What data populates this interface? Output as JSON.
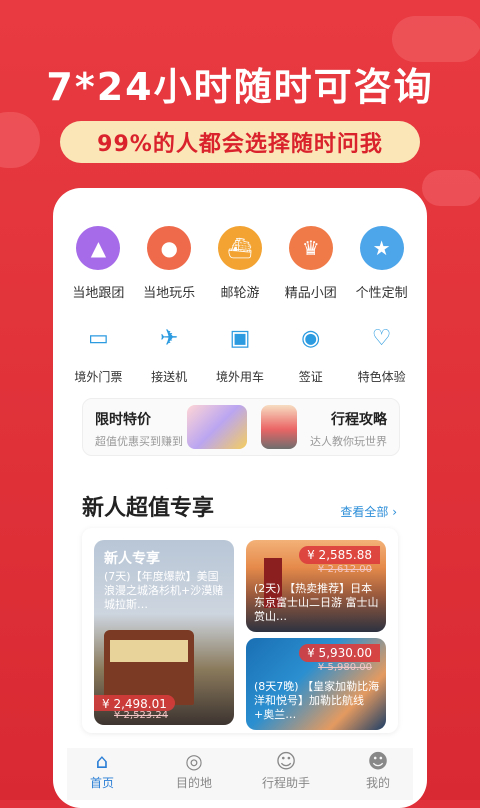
{
  "headline": "7*24小时随时可咨询",
  "subheadline": "99%的人都会选择随时问我",
  "categories_primary": [
    {
      "label": "当地跟团",
      "icon": "mountain-icon",
      "color": "#a56be8"
    },
    {
      "label": "当地玩乐",
      "icon": "location-pin-icon",
      "color": "#ef6a4a"
    },
    {
      "label": "邮轮游",
      "icon": "cruise-ship-icon",
      "color": "#f2a331"
    },
    {
      "label": "精品小团",
      "icon": "crown-icon",
      "color": "#f07a48"
    },
    {
      "label": "个性定制",
      "icon": "star-badge-icon",
      "color": "#4da5ea"
    }
  ],
  "categories_secondary": [
    {
      "label": "境外门票",
      "icon": "ticket-icon"
    },
    {
      "label": "接送机",
      "icon": "airplane-icon"
    },
    {
      "label": "境外用车",
      "icon": "bus-icon"
    },
    {
      "label": "签证",
      "icon": "passport-icon"
    },
    {
      "label": "特色体验",
      "icon": "heart-icon"
    }
  ],
  "promo": {
    "left_title": "限时特价",
    "left_sub": "超值优惠买到赚到",
    "right_title": "行程攻略",
    "right_sub": "达人教你玩世界"
  },
  "section": {
    "title": "新人超值专享",
    "see_all": "查看全部"
  },
  "deals": {
    "big": {
      "tag": "新人专享",
      "desc": "(7天)【年度爆款】美国浪漫之城洛杉机+沙漠赌城拉斯…",
      "price": "¥ 2,498.01",
      "old_price": "¥ 2,523.24"
    },
    "small1": {
      "price": "¥ 2,585.88",
      "old_price": "¥ 2,612.00",
      "desc": "(2天) 【热卖推荐】日本东京富士山二日游 富士山赏山…"
    },
    "small2": {
      "price": "¥ 5,930.00",
      "old_price": "¥ 5,980.00",
      "desc": "(8天7晚) 【皇家加勒比海洋和悦号】加勒比航线+奥兰…"
    }
  },
  "nav": [
    {
      "label": "首页",
      "icon": "home-icon",
      "active": true
    },
    {
      "label": "目的地",
      "icon": "destination-icon"
    },
    {
      "label": "行程助手",
      "icon": "assistant-icon"
    },
    {
      "label": "我的",
      "icon": "profile-icon"
    }
  ]
}
